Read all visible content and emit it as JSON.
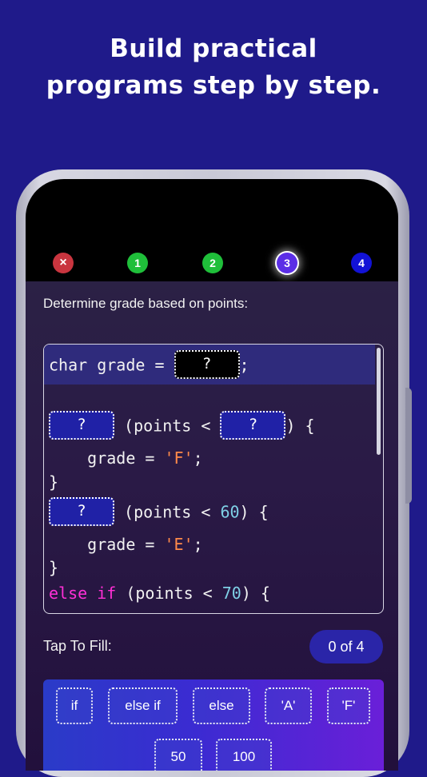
{
  "headline": {
    "line1": "Build practical",
    "line2": "programs step by step."
  },
  "progress": {
    "close": "×",
    "steps": [
      "1",
      "2",
      "3",
      "4"
    ],
    "current": "3"
  },
  "prompt": "Determine grade based on points:",
  "code": {
    "blank_char": "?",
    "line1_a": "char grade = ",
    "line1_b": ";",
    "line3_a": " (points < ",
    "line3_b": ") {",
    "line4_a": "    grade = ",
    "line4_str": "'F'",
    "line4_b": ";",
    "line5": "}",
    "line6_a": " (points < ",
    "line6_num": "60",
    "line6_b": ") {",
    "line7_a": "    grade = ",
    "line7_str": "'E'",
    "line7_b": ";",
    "line8": "}",
    "line9_kw": "else if",
    "line9_a": " (points < ",
    "line9_num": "70",
    "line9_b": ") {"
  },
  "tap_to_fill": {
    "label": "Tap To Fill:",
    "counter": "0 of 4",
    "options": [
      "if",
      "else if",
      "else",
      "'A'",
      "'F'",
      "50",
      "100"
    ]
  }
}
